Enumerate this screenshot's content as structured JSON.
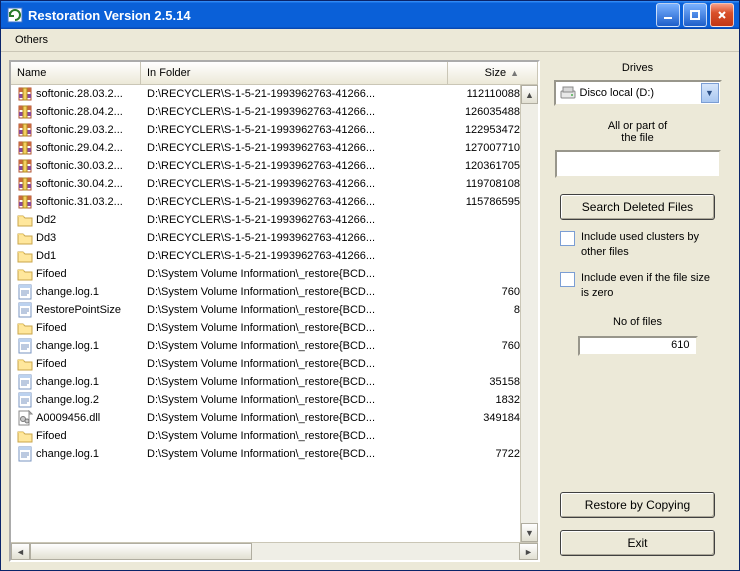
{
  "window": {
    "title": "Restoration Version 2.5.14"
  },
  "menu": {
    "others": "Others"
  },
  "columns": {
    "name": "Name",
    "folder": "In Folder",
    "size": "Size"
  },
  "rows": [
    {
      "icon": "archive",
      "name": "softonic.28.03.2...",
      "folder": "D:\\RECYCLER\\S-1-5-21-1993962763-41266...",
      "size": "112110088"
    },
    {
      "icon": "archive",
      "name": "softonic.28.04.2...",
      "folder": "D:\\RECYCLER\\S-1-5-21-1993962763-41266...",
      "size": "126035488"
    },
    {
      "icon": "archive",
      "name": "softonic.29.03.2...",
      "folder": "D:\\RECYCLER\\S-1-5-21-1993962763-41266...",
      "size": "122953472"
    },
    {
      "icon": "archive",
      "name": "softonic.29.04.2...",
      "folder": "D:\\RECYCLER\\S-1-5-21-1993962763-41266...",
      "size": "127007710"
    },
    {
      "icon": "archive",
      "name": "softonic.30.03.2...",
      "folder": "D:\\RECYCLER\\S-1-5-21-1993962763-41266...",
      "size": "120361705"
    },
    {
      "icon": "archive",
      "name": "softonic.30.04.2...",
      "folder": "D:\\RECYCLER\\S-1-5-21-1993962763-41266...",
      "size": "119708108"
    },
    {
      "icon": "archive",
      "name": "softonic.31.03.2...",
      "folder": "D:\\RECYCLER\\S-1-5-21-1993962763-41266...",
      "size": "115786595"
    },
    {
      "icon": "folder",
      "name": "Dd2",
      "folder": "D:\\RECYCLER\\S-1-5-21-1993962763-41266...",
      "size": ""
    },
    {
      "icon": "folder",
      "name": "Dd3",
      "folder": "D:\\RECYCLER\\S-1-5-21-1993962763-41266...",
      "size": ""
    },
    {
      "icon": "folder",
      "name": "Dd1",
      "folder": "D:\\RECYCLER\\S-1-5-21-1993962763-41266...",
      "size": ""
    },
    {
      "icon": "folder",
      "name": "Fifoed",
      "folder": "D:\\System Volume Information\\_restore{BCD...",
      "size": ""
    },
    {
      "icon": "log",
      "name": "change.log.1",
      "folder": "D:\\System Volume Information\\_restore{BCD...",
      "size": "760"
    },
    {
      "icon": "log",
      "name": "RestorePointSize",
      "folder": "D:\\System Volume Information\\_restore{BCD...",
      "size": "8"
    },
    {
      "icon": "folder",
      "name": "Fifoed",
      "folder": "D:\\System Volume Information\\_restore{BCD...",
      "size": ""
    },
    {
      "icon": "log",
      "name": "change.log.1",
      "folder": "D:\\System Volume Information\\_restore{BCD...",
      "size": "760"
    },
    {
      "icon": "folder",
      "name": "Fifoed",
      "folder": "D:\\System Volume Information\\_restore{BCD...",
      "size": ""
    },
    {
      "icon": "log",
      "name": "change.log.1",
      "folder": "D:\\System Volume Information\\_restore{BCD...",
      "size": "35158"
    },
    {
      "icon": "log",
      "name": "change.log.2",
      "folder": "D:\\System Volume Information\\_restore{BCD...",
      "size": "1832"
    },
    {
      "icon": "dll",
      "name": "A0009456.dll",
      "folder": "D:\\System Volume Information\\_restore{BCD...",
      "size": "349184"
    },
    {
      "icon": "folder",
      "name": "Fifoed",
      "folder": "D:\\System Volume Information\\_restore{BCD...",
      "size": ""
    },
    {
      "icon": "log",
      "name": "change.log.1",
      "folder": "D:\\System Volume Information\\_restore{BCD...",
      "size": "7722"
    }
  ],
  "side": {
    "drives_label": "Drives",
    "drive_selected": "Disco local (D:)",
    "filter_label": "All or part of\nthe file",
    "search_btn": "Search Deleted Files",
    "chk_used": "Include used clusters by other files",
    "chk_zero": "Include even if the file size is zero",
    "nofiles_label": "No of files",
    "nofiles_value": "610",
    "restore_btn": "Restore by Copying",
    "exit_btn": "Exit"
  }
}
